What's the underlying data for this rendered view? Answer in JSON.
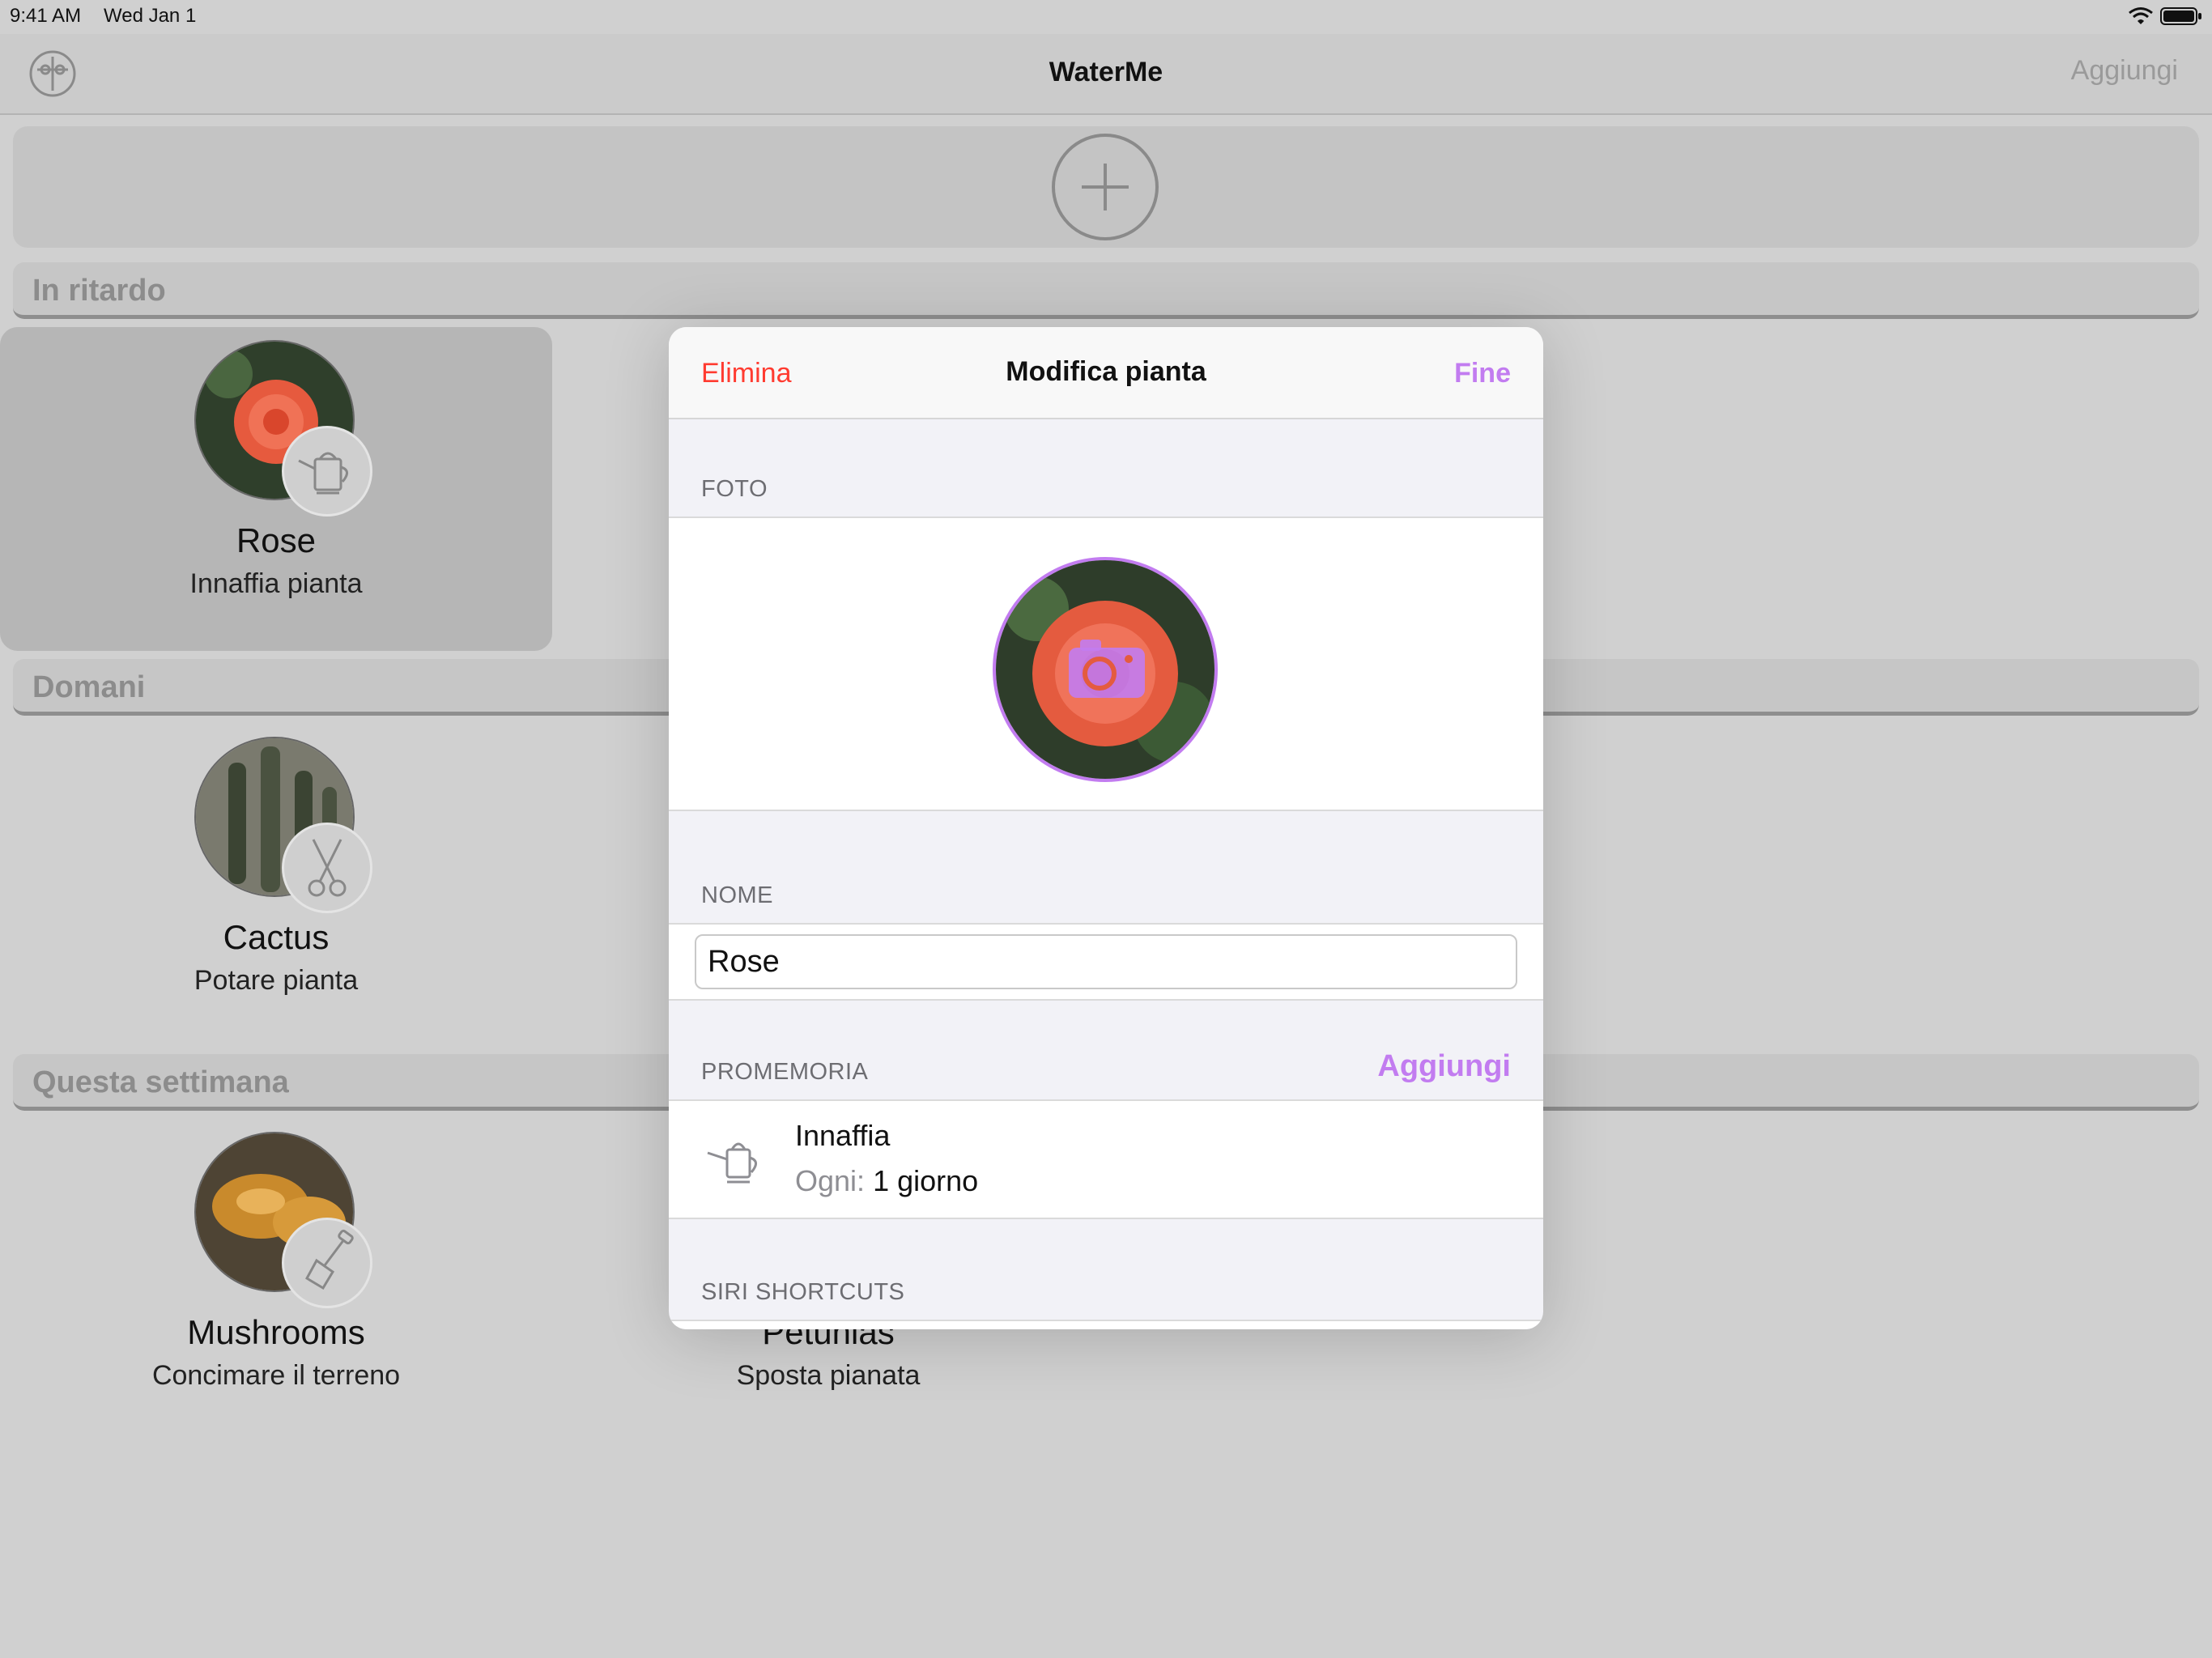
{
  "status_bar": {
    "time": "9:41 AM",
    "date": "Wed Jan 1"
  },
  "nav": {
    "title": "WaterMe",
    "add_label": "Aggiungi"
  },
  "sections": [
    {
      "title": "In ritardo"
    },
    {
      "title": "Domani"
    },
    {
      "title": "Questa settimana"
    }
  ],
  "plants": [
    {
      "name": "Rose",
      "task": "Innaffia pianta",
      "badge": "watering-can-icon"
    },
    {
      "name": "Cactus",
      "task": "Potare pianta",
      "badge": "scissors-icon"
    },
    {
      "name": "Mushrooms",
      "task": "Concimare il terreno",
      "badge": "shovel-icon"
    },
    {
      "name": "Petunias",
      "task": "Sposta pianata"
    }
  ],
  "modal": {
    "delete_label": "Elimina",
    "title": "Modifica pianta",
    "done_label": "Fine",
    "photo_section": "FOTO",
    "name_section": "NOME",
    "name_value": "Rose",
    "reminders_section": "PROMEMORIA",
    "reminders_add": "Aggiungi",
    "reminder": {
      "title": "Innaffia",
      "every_label": "Ogni:",
      "every_value": "1 giorno"
    },
    "siri_section": "SIRI SHORTCUTS"
  },
  "colors": {
    "accent": "#c27cf0",
    "destructive": "#ff3b30"
  }
}
